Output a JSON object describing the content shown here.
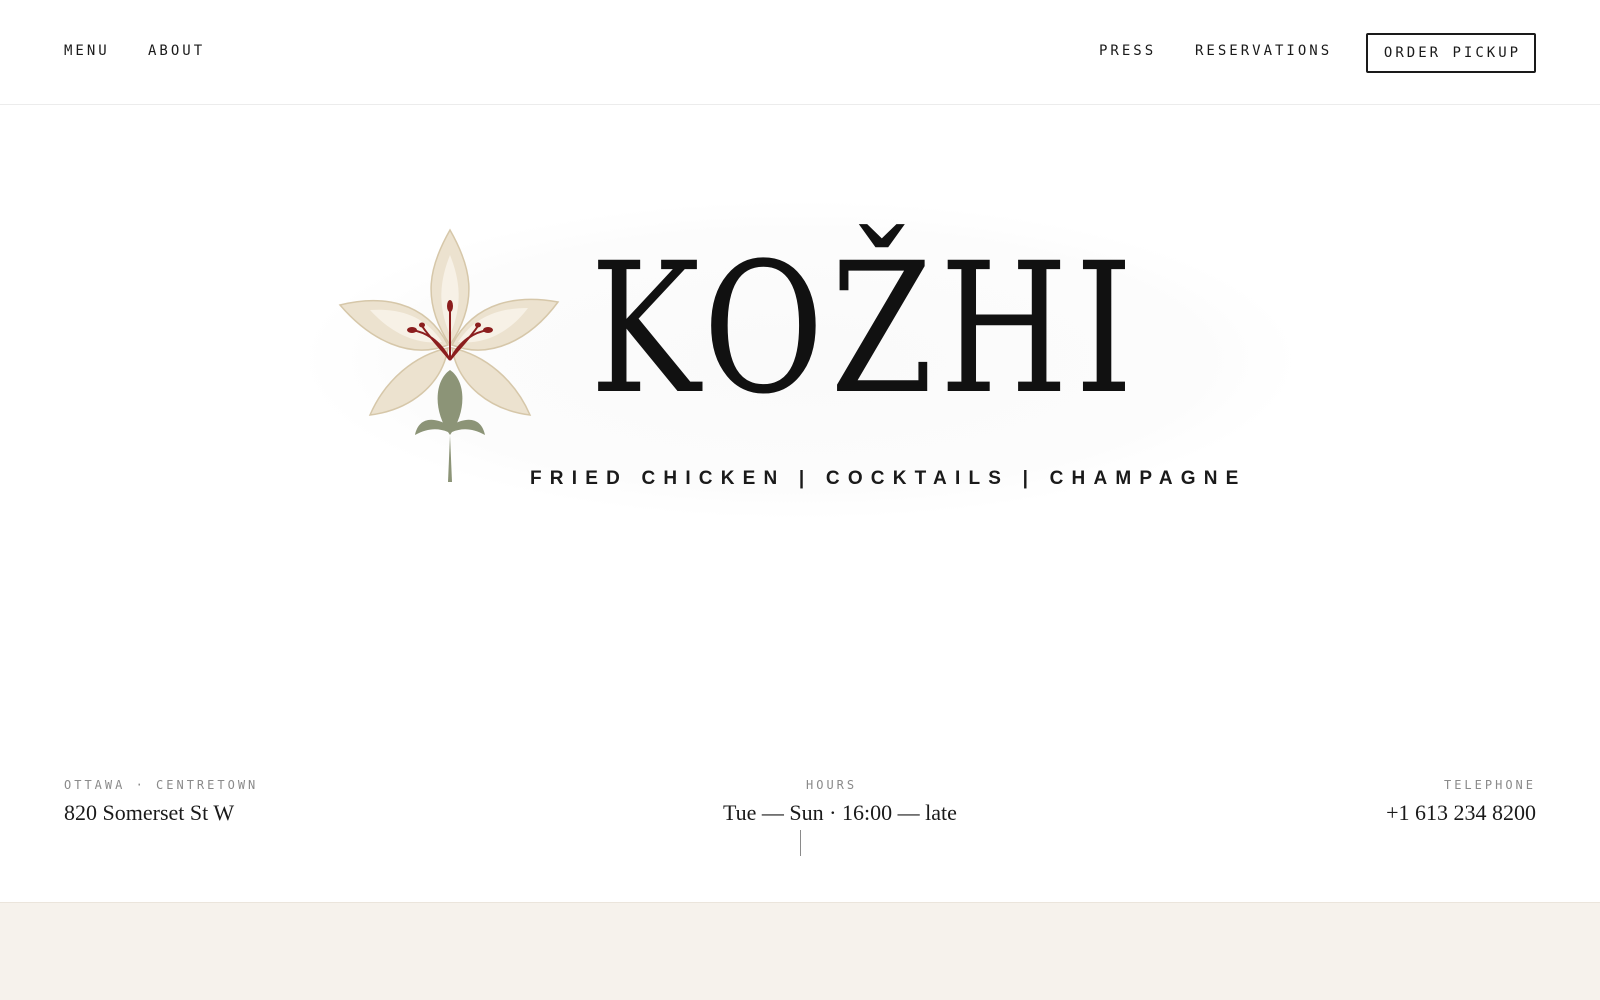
{
  "nav": {
    "left": [
      "MENU",
      "ABOUT"
    ],
    "right": [
      "PRESS",
      "RESERVATIONS"
    ],
    "cta": "ORDER PICKUP"
  },
  "brand": {
    "name": "KOŽHI",
    "tagline": "FRIED CHICKEN | COCKTAILS | CHAMPAGNE"
  },
  "info": {
    "location_label": "OTTAWA · CENTRETOWN",
    "address": "820 Somerset St W",
    "hours_label": "HOURS",
    "hours": "Tue — Sun · 16:00 — late",
    "phone_label": "TELEPHONE",
    "phone": "+1 613 234 8200"
  },
  "colors": {
    "accent_red": "#8b1d1d",
    "petal": "#ece2cf",
    "stem": "#8c9477",
    "band": "#f6f2ec"
  },
  "icons": [
    "lily-flower-logo",
    "scroll-indicator"
  ]
}
